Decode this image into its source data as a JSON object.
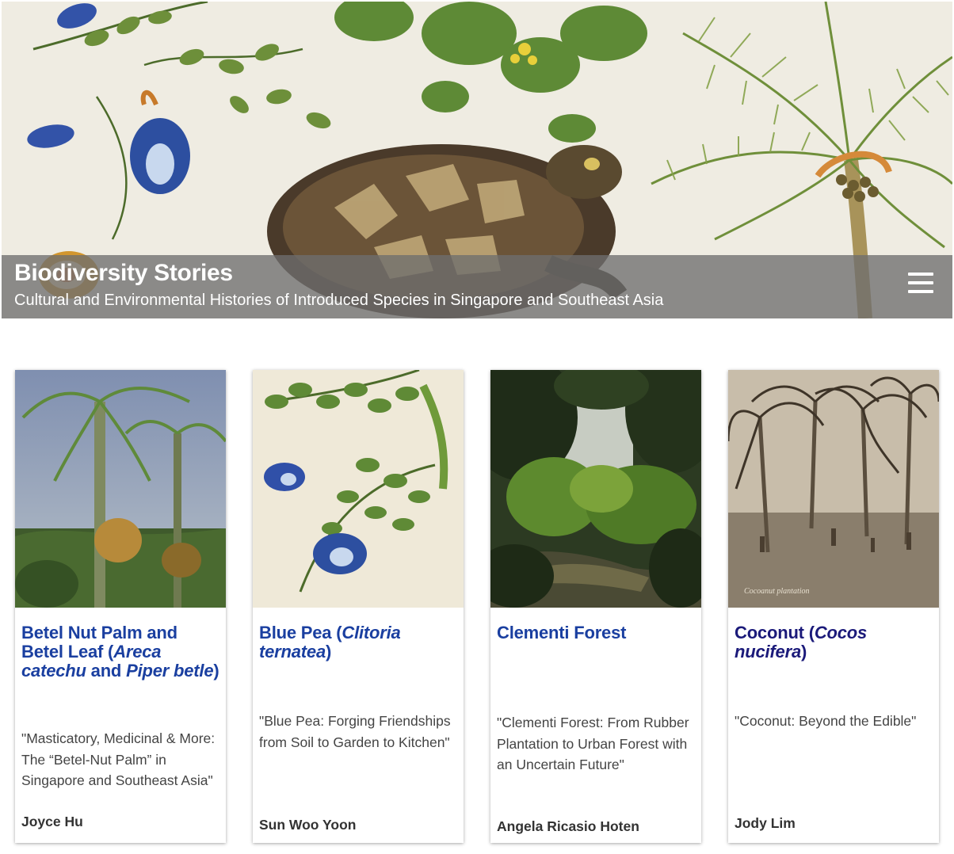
{
  "site": {
    "title": "Biodiversity Stories",
    "subtitle": "Cultural and Environmental Histories of Introduced Species in Singapore and Southeast Asia"
  },
  "cards": [
    {
      "title_parts": [
        "Betel Nut Palm and Betel Leaf (",
        "Areca catechu",
        " and ",
        "Piper betle",
        ")"
      ],
      "quote": "\"Masticatory, Medicinal & More: The “Betel-Nut Palm” in Singapore and Southeast Asia\"",
      "author": "Joyce Hu"
    },
    {
      "title_parts": [
        "Blue Pea (",
        "Clitoria ternatea",
        ")"
      ],
      "quote": "\"Blue Pea: Forging Friendships from Soil to Garden to Kitchen\"",
      "author": "Sun Woo Yoon"
    },
    {
      "title_parts": [
        "Clementi Forest"
      ],
      "quote": "\"Clementi Forest: From Rubber Plantation to Urban Forest with an Uncertain Future\"",
      "author": "Angela Ricasio Hoten"
    },
    {
      "title_parts": [
        "Coconut (",
        "Cocos nucifera",
        ")"
      ],
      "quote": "\"Coconut: Beyond the Edible\"",
      "author": "Jody Lim"
    }
  ],
  "colors": {
    "title_blue": "#1a3fa0",
    "title_visited": "#1b1a7a",
    "hero_bar": "#6e6e6e"
  },
  "icons": [
    "menu-icon"
  ]
}
